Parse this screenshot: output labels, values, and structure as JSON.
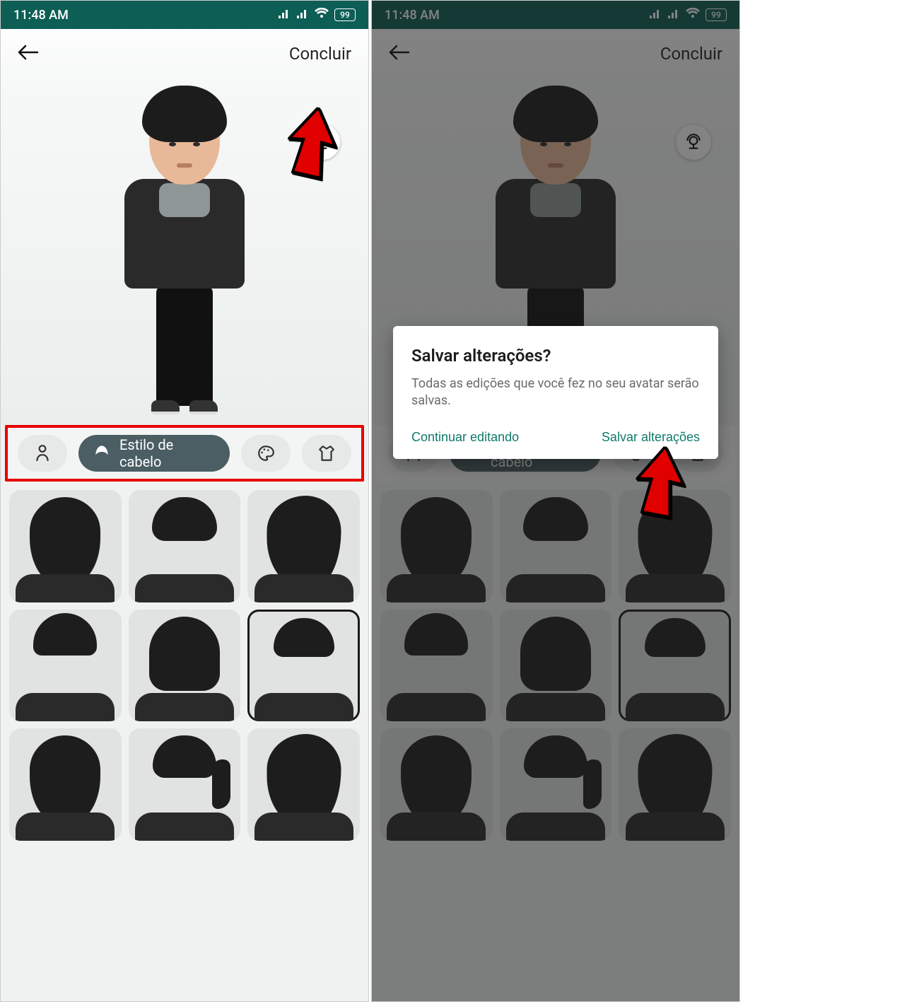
{
  "status": {
    "time": "11:48 AM",
    "battery": "99"
  },
  "header": {
    "concluir": "Concluir"
  },
  "category": {
    "active_label": "Estilo de cabelo",
    "icons": {
      "body": "body-icon",
      "hair": "hair-icon",
      "palette": "palette-icon",
      "outfit": "outfit-icon"
    }
  },
  "grid": {
    "styles": [
      "long",
      "short",
      "wavy",
      "pomp",
      "bob",
      "crop",
      "long",
      "pony",
      "wavy"
    ],
    "selected_index": 5
  },
  "dialog": {
    "title": "Salvar alterações?",
    "body": "Todas as edições que você fez no seu avatar serão salvas.",
    "btn_continue": "Continuar editando",
    "btn_save": "Salvar alterações"
  }
}
